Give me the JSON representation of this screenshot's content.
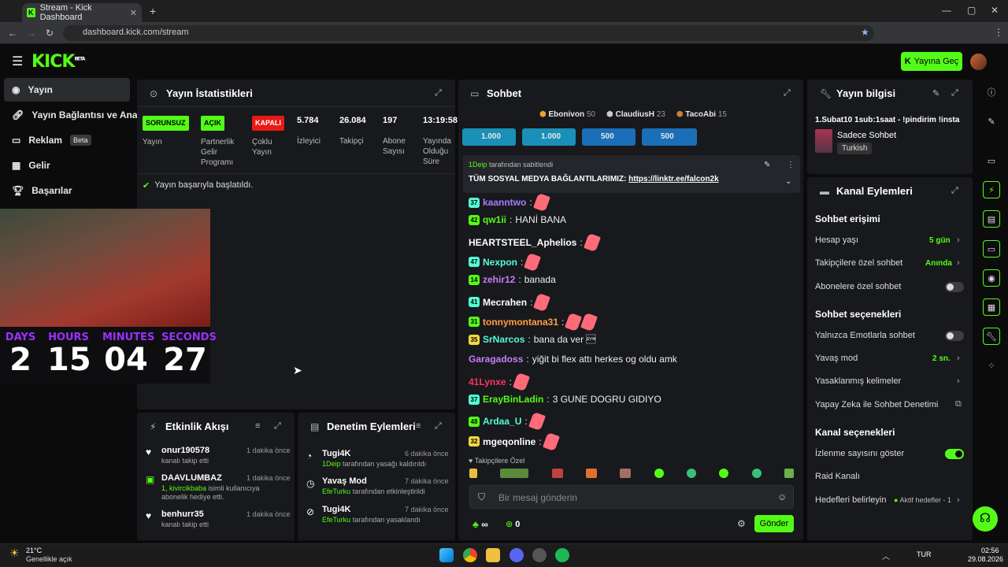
{
  "browser": {
    "tab_title": "Stream - Kick Dashboard",
    "url": "dashboard.kick.com/stream"
  },
  "header": {
    "logo": "KICK",
    "logo_beta": "BETA",
    "go_live": "Yayına Geç"
  },
  "nav": [
    {
      "label": "Yayın",
      "icon": "broadcast-icon"
    },
    {
      "label": "Yayın Bağlantısı ve Anahta",
      "icon": "link-icon"
    },
    {
      "label": "Reklam",
      "badge": "Beta",
      "icon": "ad-icon"
    },
    {
      "label": "Gelir",
      "icon": "revenue-icon"
    },
    {
      "label": "Başarılar",
      "icon": "trophy-icon"
    }
  ],
  "countdown": {
    "labels": [
      "DAYS",
      "HOURS",
      "MINUTES",
      "SECONDS"
    ],
    "values": [
      "2",
      "15",
      "04",
      "27"
    ]
  },
  "stats": {
    "title": "Yayın İstatistikleri",
    "items": [
      {
        "tag": "SORUNSUZ",
        "label": "Yayın",
        "tag_color": "#53fc18"
      },
      {
        "tag": "AÇIK",
        "label": "Partnerlik Gelir Programı",
        "tag_color": "#53fc18"
      },
      {
        "tag": "KAPALI",
        "label": "Çoklu Yayın",
        "tag_color": "#e91916"
      },
      {
        "value": "5.784",
        "label": "İzleyici"
      },
      {
        "value": "26.084",
        "label": "Takipçi"
      },
      {
        "value": "197",
        "label": "Abone Sayısı"
      },
      {
        "value": "13:19:58",
        "label": "Yayında Olduğu Süre"
      }
    ],
    "status": "Yayın başarıyla başlatıldı."
  },
  "activity": {
    "title": "Etkinlik Akışı",
    "items": [
      {
        "name": "onur190578",
        "desc": "kanalı takip etti",
        "time": "1 dakika önce"
      },
      {
        "name": "DAAVLUMBAZ",
        "desc_highlight": "1, kivircikbaba",
        "desc": " isimli kullanıcıya abonelik hediye etti.",
        "time": "1 dakika önce"
      },
      {
        "name": "benhurr35",
        "desc": "kanalı takip etti",
        "time": "1 dakika önce"
      }
    ]
  },
  "moderation": {
    "title": "Denetim Eylemleri",
    "items": [
      {
        "name": "Tugi4K",
        "actor": "1Deip",
        "desc": " tarafından yasağı kaldırıldı",
        "time": "6 dakika önce"
      },
      {
        "name": "Yavaş Mod",
        "actor": "EfeTurku",
        "desc": " tarafından etkinleştirildi",
        "time": "7 dakika önce"
      },
      {
        "name": "Tugi4K",
        "actor": "EfeTurku",
        "desc": " tarafından yasaklandı",
        "time": "7 dakika önce"
      }
    ]
  },
  "chat": {
    "title": "Sohbet",
    "leaders": [
      {
        "name": "Ebonivon",
        "count": "50"
      },
      {
        "name": "ClaudiusH",
        "count": "23"
      },
      {
        "name": "TacoAbi",
        "count": "15"
      }
    ],
    "goals": [
      "1.000",
      "1.000",
      "500",
      "500"
    ],
    "pinned": {
      "by": "1Deip",
      "by_suffix": " tarafından sabitlendi",
      "text": "TÜM SOSYAL MEDYA BAĞLANTILARIMIZ: ",
      "link": "https://linktr.ee/falcon2k"
    },
    "messages": [
      {
        "lv": "37",
        "user": "kaanntwo",
        "color": "#a57bff",
        "text": "",
        "emotes": 1
      },
      {
        "lv": "42",
        "user": "qw1ii",
        "color": "#53fc18",
        "text": "HANİ BANA",
        "emotes": 0
      },
      {
        "lv": "",
        "user": "HEARTSTEEL_Aphelios",
        "color": "#ffffff",
        "text": "",
        "emotes": 1
      },
      {
        "lv": "47",
        "user": "Nexpon",
        "color": "#53fcd6",
        "text": "",
        "emotes": 1
      },
      {
        "lv": "14",
        "user": "zehir12",
        "color": "#c77dff",
        "text": "banada",
        "emotes": 0
      },
      {
        "lv": "41",
        "user": "Mecrahen",
        "color": "#ffffff",
        "text": "",
        "emotes": 1
      },
      {
        "lv": "31",
        "user": "tonnymontana31",
        "color": "#ff9f43",
        "text": "",
        "emotes": 2
      },
      {
        "lv": "35",
        "user": "SrNarcos",
        "color": "#53fcd6",
        "text": "bana da ver \u0016",
        "emotes": 0
      },
      {
        "lv": "",
        "user": "Garagadoss",
        "color": "#c77dff",
        "text": "yiğit bi flex attı herkes og oldu amk",
        "emotes": 0
      },
      {
        "lv": "",
        "user": "41Lynxe",
        "color": "#ff3366",
        "text": "",
        "emotes": 1
      },
      {
        "lv": "37",
        "user": "ErayBinLadin",
        "color": "#53fc18",
        "text": "3 GUNE DOGRU GIDIYO",
        "emotes": 0
      },
      {
        "lv": "48",
        "user": "Ardaa_U",
        "color": "#53fcd6",
        "text": "",
        "emotes": 1
      },
      {
        "lv": "32",
        "user": "mgeqonline",
        "color": "#ffffff",
        "text": "",
        "emotes": 1
      }
    ],
    "followers_only": "Takipçilere Özel",
    "input_placeholder": "Bir mesaj gönderin",
    "points": "∞",
    "score": "0",
    "send": "Gönder"
  },
  "stream_info": {
    "title": "Yayın bilgisi",
    "stream_title": "1.Subat10 1sub:1saat - !pindirim !insta",
    "category": "Sadece Sohbet",
    "language": "Turkish"
  },
  "channel_actions": {
    "title": "Kanal Eylemleri",
    "chat_access": "Sohbet erişimi",
    "account_age": {
      "label": "Hesap yaşı",
      "value": "5 gün"
    },
    "followers_chat": {
      "label": "Takipçilere özel sohbet",
      "value": "Anında"
    },
    "subs_chat": {
      "label": "Abonelere özel sohbet"
    },
    "chat_options": "Sohbet seçenekleri",
    "emote_only": {
      "label": "Yalnızca Emotlarla sohbet"
    },
    "slow_mode": {
      "label": "Yavaş mod",
      "value": "2 sn."
    },
    "banned_words": {
      "label": "Yasaklanmış kelimeler"
    },
    "ai_mod": {
      "label": "Yapay Zeka ile Sohbet Denetimi"
    },
    "channel_options": "Kanal seçenekleri",
    "show_viewers": {
      "label": "İzlenme sayısını göster"
    },
    "raid": {
      "label": "Raid Kanalı"
    },
    "goals": {
      "label": "Hedefleri belirleyin",
      "value": "Aktif hedefler - 1"
    }
  },
  "taskbar": {
    "weather_temp": "21°C",
    "weather_desc": "Genellikle açık",
    "lang": "TUR",
    "time": "02:56",
    "date": "29.08.2026"
  }
}
